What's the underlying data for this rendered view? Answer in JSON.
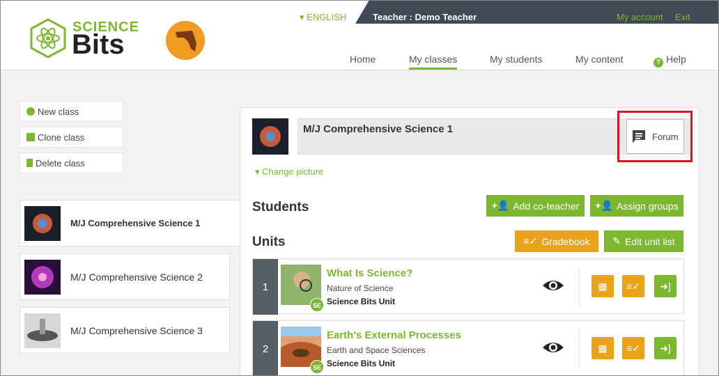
{
  "header": {
    "language": "▾ ENGLISH",
    "teacher": "Teacher : Demo Teacher",
    "my_account": "My account",
    "exit": "Exit",
    "logo_line1": "SCIENCE",
    "logo_line2": "Bits"
  },
  "nav": {
    "home": "Home",
    "my_classes": "My classes",
    "my_students": "My students",
    "my_content": "My content",
    "help": "Help",
    "active": "My classes"
  },
  "sidebar": {
    "new_class": "New class",
    "clone_class": "Clone class",
    "delete_class": "Delete class",
    "classes": [
      {
        "name": "M/J Comprehensive Science 1",
        "selected": true
      },
      {
        "name": "M/J Comprehensive Science 2",
        "selected": false
      },
      {
        "name": "M/J Comprehensive Science 3",
        "selected": false
      }
    ]
  },
  "main": {
    "class_title": "M/J Comprehensive Science 1",
    "forum": "Forum",
    "change_picture": "Change picture",
    "students_heading": "Students",
    "add_co_teacher": "Add co-teacher",
    "assign_groups": "Assign groups",
    "units_heading": "Units",
    "gradebook": "Gradebook",
    "edit_unit_list": "Edit unit list",
    "units": [
      {
        "number": "1",
        "title": "What Is Science?",
        "subtitle": "Nature of Science",
        "type": "Science Bits Unit",
        "badge": "SE"
      },
      {
        "number": "2",
        "title": "Earth's External Processes",
        "subtitle": "Earth and Space Sciences",
        "type": "Science Bits Unit",
        "badge": "SE"
      }
    ]
  },
  "colors": {
    "accent_green": "#7cb82f",
    "accent_orange": "#e8a21b",
    "topbar": "#3f4a55",
    "highlight_red": "#e0101a"
  },
  "icons": [
    "atom-logo-icon",
    "florida-state-icon",
    "help-circle-icon",
    "plus-circle-icon",
    "clone-icon",
    "trash-icon",
    "forum-chat-icon",
    "add-person-icon",
    "gradebook-icon",
    "edit-icon",
    "eye-icon",
    "calendar-icon",
    "grade-list-icon",
    "enter-icon"
  ]
}
